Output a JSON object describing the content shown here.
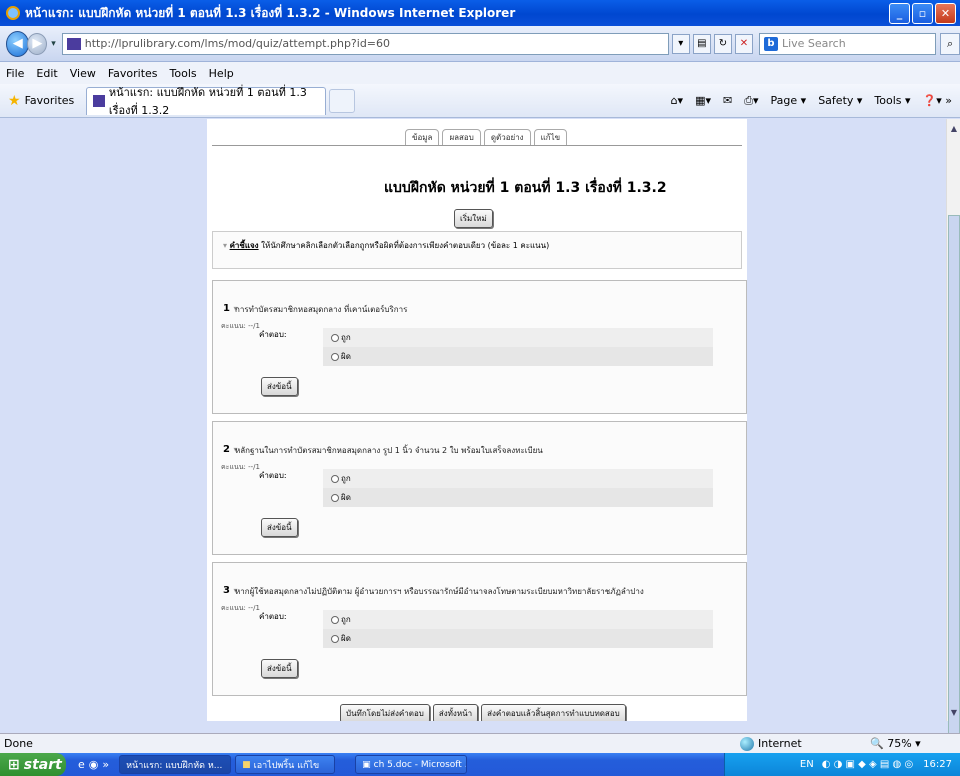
{
  "window": {
    "title": "หน้าแรก: แบบฝึกหัด หน่วยที่ 1 ตอนที่ 1.3 เรื่องที่ 1.3.2 - Windows Internet Explorer"
  },
  "address": {
    "url": "http://lprulibrary.com/lms/mod/quiz/attempt.php?id=60",
    "search_placeholder": "Live Search"
  },
  "menu": [
    "File",
    "Edit",
    "View",
    "Favorites",
    "Tools",
    "Help"
  ],
  "favbar": {
    "favorites_label": "Favorites",
    "tab_title": "หน้าแรก: แบบฝึกหัด หน่วยที่ 1 ตอนที่ 1.3 เรื่องที่ 1.3.2",
    "cmd": [
      "Page ▾",
      "Safety ▾",
      "Tools ▾"
    ]
  },
  "quiz": {
    "tabs": [
      "ข้อมูล",
      "ผลสอบ",
      "ดูตัวอย่าง",
      "แก้ไข"
    ],
    "title": "แบบฝึกหัด หน่วยที่ 1 ตอนที่ 1.3 เรื่องที่ 1.3.2",
    "restart": "เริ่มใหม่",
    "instruction_label": "คำชี้แจง",
    "instruction_text": " ให้นักศึกษาคลิกเลือกตัวเลือกถูกหรือผิดที่ต้องการเพียงคำตอบเดียว (ข้อละ 1 คะแนน)",
    "answer_label": "คำตอบ:",
    "score": "คะแนน: --/1",
    "submit_one": "ส่งข้อนี้",
    "questions": [
      {
        "num": "1",
        "text": "การทำบัตรสมาชิกหอสมุดกลาง ที่เคาน์เตอร์บริการ",
        "opt_true": "ถูก",
        "opt_false": "ผิด"
      },
      {
        "num": "2",
        "text": "หลักฐานในการทำบัตรสมาชิกหอสมุดกลาง รูป 1 นิ้ว จำนวน 2 ใบ พร้อมใบเสร็จลงทะเบียน",
        "opt_true": "ถูก",
        "opt_false": "ผิด"
      },
      {
        "num": "3",
        "text": "หากผู้ใช้หอสมุดกลางไม่ปฏิบัติตาม ผู้อำนวยการฯ หรือบรรณารักษ์มีอำนาจลงโทษตามระเบียบมหาวิทยาลัยราชภัฏลำปาง",
        "opt_true": "ถูก",
        "opt_false": "ผิด"
      }
    ],
    "footer_buttons": [
      "บันทึกโดยไม่ส่งคำตอบ",
      "ส่งทั้งหน้า",
      "ส่งคำตอบแล้วสิ้นสุดการทำแบบทดสอบ"
    ]
  },
  "status": {
    "left": "Done",
    "zone": "Internet",
    "zoom": "75%"
  },
  "taskbar": {
    "start": "start",
    "tasks": [
      "หน้าแรก: แบบฝึกหัด ห...",
      "เอาไปพริ้น แก้ไข",
      "ch 5.doc - Microsoft ..."
    ],
    "tray_lang": "EN",
    "clock": "16:27"
  }
}
